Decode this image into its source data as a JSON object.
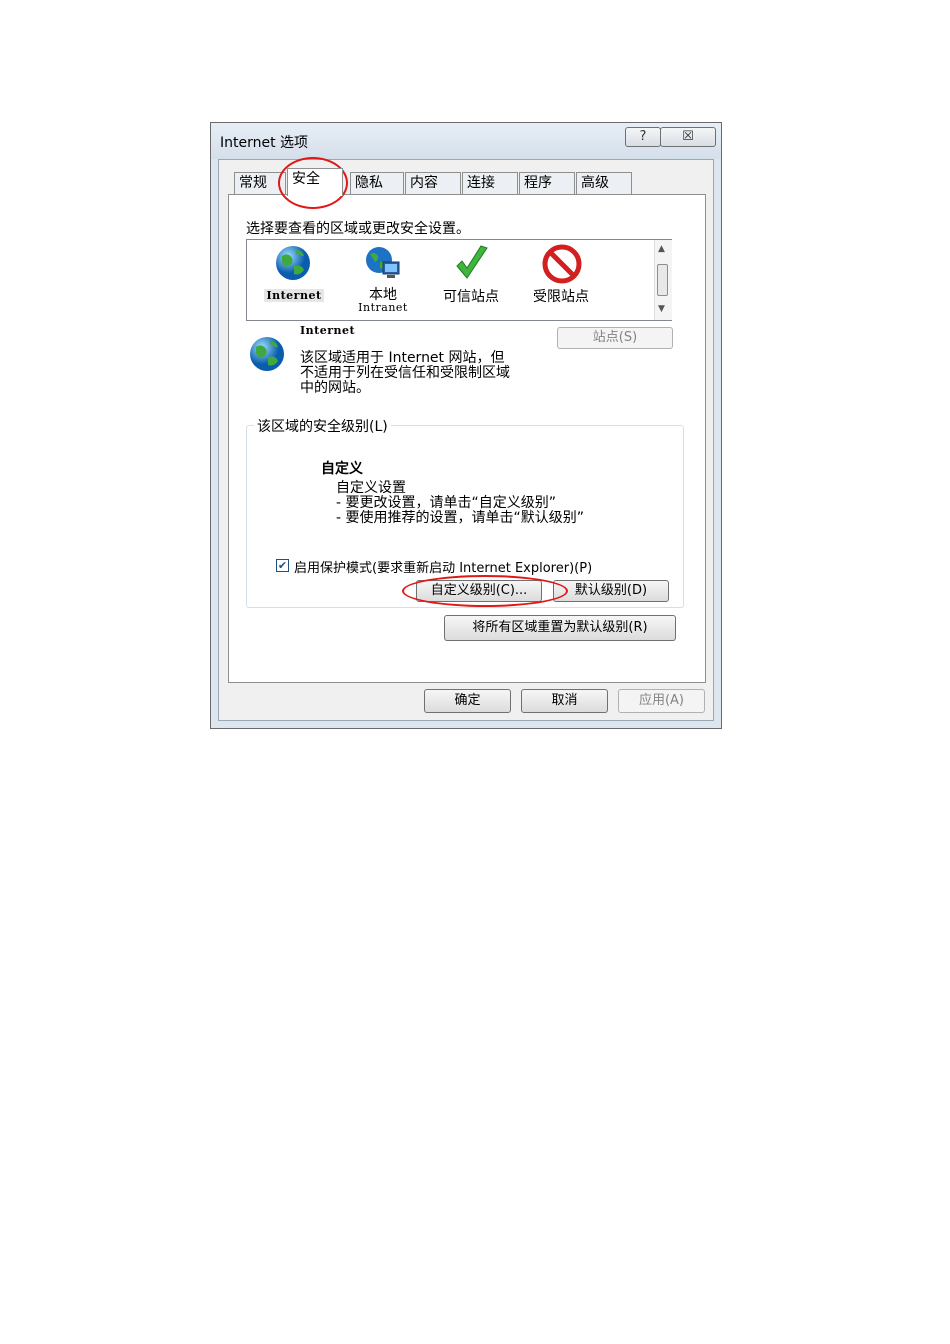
{
  "window": {
    "title": "Internet 选项",
    "help_glyph": "?",
    "close_glyph": "☒"
  },
  "tabs": [
    "常规",
    "安全",
    "隐私",
    "内容",
    "连接",
    "程序",
    "高级"
  ],
  "active_tab": "安全",
  "security": {
    "select_zone_prompt": "选择要查看的区域或更改安全设置。",
    "zones": [
      {
        "label": "Internet",
        "sub": "",
        "icon": "globe-icon"
      },
      {
        "label": "本地",
        "sub": "Intranet",
        "icon": "local-intranet-icon"
      },
      {
        "label": "可信站点",
        "sub": "",
        "icon": "checkmark-icon"
      },
      {
        "label": "受限站点",
        "sub": "",
        "icon": "restricted-icon"
      }
    ],
    "selected_zone_name": "Internet",
    "selected_zone_desc_1": "该区域适用于 Internet 网站，但",
    "selected_zone_desc_2": "不适用于列在受信任和受限制区域",
    "selected_zone_desc_3": "中的网站。",
    "sites_button": "站点(S)",
    "level_group_label": "该区域的安全级别(L)",
    "level_name": "自定义",
    "level_lines": [
      "自定义设置",
      "- 要更改设置，请单击“自定义级别”",
      "- 要使用推荐的设置，请单击“默认级别”"
    ],
    "protected_mode_label": "启用保护模式(要求重新启动 Internet Explorer)(P)",
    "protected_mode_checked": true,
    "custom_level_button": "自定义级别(C)...",
    "default_level_button": "默认级别(D)",
    "reset_all_button": "将所有区域重置为默认级别(R)"
  },
  "footer": {
    "ok": "确定",
    "cancel": "取消",
    "apply": "应用(A)"
  },
  "annotation_color": "#e01818"
}
